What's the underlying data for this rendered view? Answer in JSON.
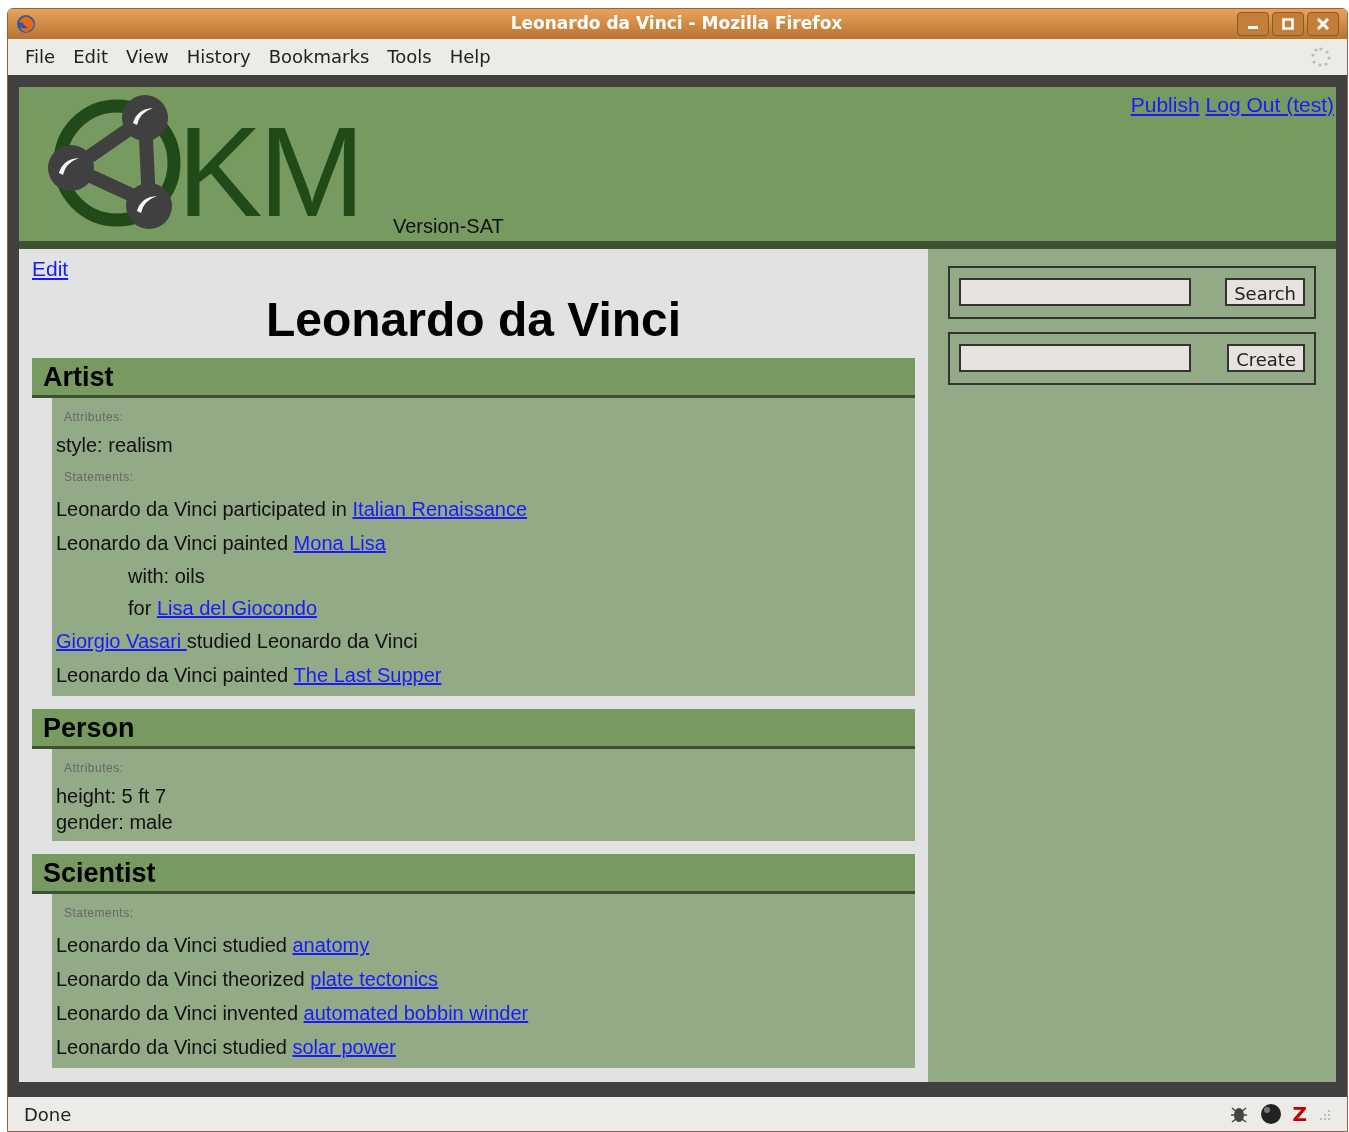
{
  "window": {
    "title": "Leonardo da Vinci - Mozilla Firefox"
  },
  "menu": [
    "File",
    "Edit",
    "View",
    "History",
    "Bookmarks",
    "Tools",
    "Help"
  ],
  "header": {
    "logo_text": "KM",
    "version": "Version-SAT",
    "links": [
      "Publish",
      "Log Out (test)"
    ]
  },
  "edit_link": "Edit",
  "page_title": "Leonardo da Vinci",
  "sections": [
    {
      "title": "Artist",
      "attributes_label": "Attributes:",
      "attributes": [
        "style: realism"
      ],
      "statements_label": "Statements:",
      "statements": [
        {
          "parts": [
            {
              "kind": "text",
              "text": "Leonardo da Vinci participated in "
            },
            {
              "kind": "link",
              "text": "Italian Renaissance"
            }
          ]
        },
        {
          "parts": [
            {
              "kind": "text",
              "text": "Leonardo da Vinci painted "
            },
            {
              "kind": "link",
              "text": "Mona Lisa"
            }
          ],
          "qualifiers": [
            {
              "parts": [
                {
                  "kind": "text",
                  "text": "with: oils"
                }
              ]
            },
            {
              "parts": [
                {
                  "kind": "text",
                  "text": "for "
                },
                {
                  "kind": "link",
                  "text": "Lisa del Giocondo"
                }
              ]
            }
          ]
        },
        {
          "parts": [
            {
              "kind": "link",
              "text": "Giorgio Vasari "
            },
            {
              "kind": "text",
              "text": "studied Leonardo da Vinci"
            }
          ]
        },
        {
          "parts": [
            {
              "kind": "text",
              "text": "Leonardo da Vinci painted "
            },
            {
              "kind": "link",
              "text": "The Last Supper"
            }
          ]
        }
      ]
    },
    {
      "title": "Person",
      "attributes_label": "Attributes:",
      "attributes": [
        "height: 5 ft 7",
        "gender: male"
      ]
    },
    {
      "title": "Scientist",
      "statements_label": "Statements:",
      "statements": [
        {
          "parts": [
            {
              "kind": "text",
              "text": "Leonardo da Vinci studied "
            },
            {
              "kind": "link",
              "text": "anatomy"
            }
          ]
        },
        {
          "parts": [
            {
              "kind": "text",
              "text": "Leonardo da Vinci theorized "
            },
            {
              "kind": "link",
              "text": "plate tectonics"
            }
          ]
        },
        {
          "parts": [
            {
              "kind": "text",
              "text": "Leonardo da Vinci invented "
            },
            {
              "kind": "link",
              "text": "automated bobbin winder"
            }
          ]
        },
        {
          "parts": [
            {
              "kind": "text",
              "text": "Leonardo da Vinci studied "
            },
            {
              "kind": "link",
              "text": "solar power"
            }
          ]
        }
      ]
    }
  ],
  "sidebar": {
    "forms": [
      {
        "button": "Search"
      },
      {
        "button": "Create"
      }
    ]
  },
  "status_bar": {
    "text": "Done",
    "icon_letter": "Z"
  }
}
